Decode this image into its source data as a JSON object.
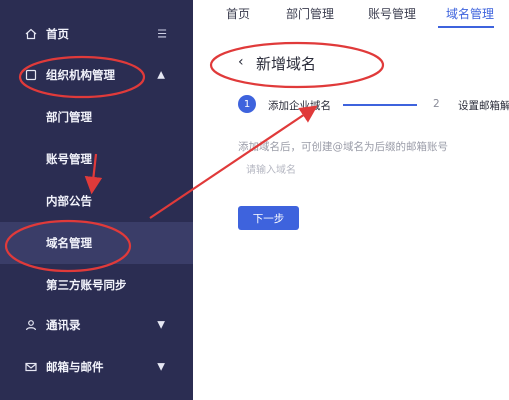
{
  "sidebar": {
    "items": [
      {
        "label": "首页",
        "icon": "home-icon"
      },
      {
        "label": "组织机构管理",
        "icon": "org-icon"
      },
      {
        "label": "部门管理"
      },
      {
        "label": "账号管理"
      },
      {
        "label": "内部公告"
      },
      {
        "label": "域名管理"
      },
      {
        "label": "第三方账号同步"
      },
      {
        "label": "通讯录",
        "icon": "contacts-icon"
      },
      {
        "label": "邮箱与邮件",
        "icon": "mail-icon"
      }
    ]
  },
  "tabs": [
    {
      "label": "首页"
    },
    {
      "label": "部门管理"
    },
    {
      "label": "账号管理"
    },
    {
      "label": "域名管理"
    }
  ],
  "page": {
    "title": "新增域名",
    "steps": [
      {
        "num": "1",
        "label": "添加企业域名"
      },
      {
        "num": "2",
        "label": "设置邮箱解"
      }
    ],
    "hint": "添加域名后，可创建@域名为后缀的邮箱账号",
    "input_placeholder": "请输入域名",
    "next_label": "下一步"
  },
  "colors": {
    "sidebar_bg": "#2b2d52",
    "accent": "#3e63dd",
    "annotation_red": "#e03a3a"
  }
}
